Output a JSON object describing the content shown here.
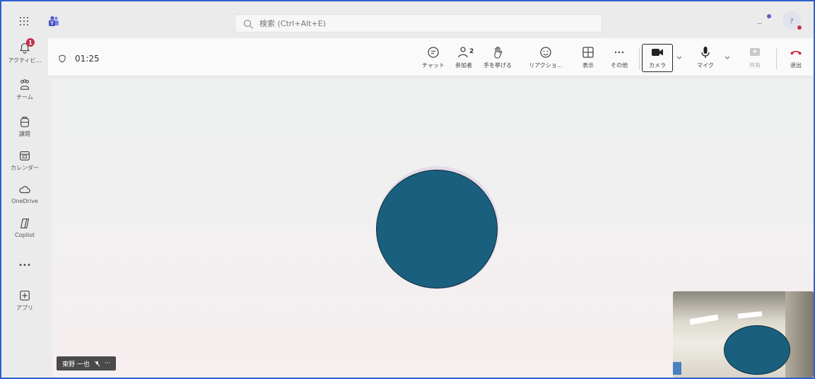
{
  "search": {
    "placeholder": "検索 (Ctrl+Alt+E)"
  },
  "top_avatar": {
    "initial": "ｱ"
  },
  "rail": {
    "items": [
      {
        "label": "アクティビ…",
        "badge": "1"
      },
      {
        "label": "チーム"
      },
      {
        "label": "課題"
      },
      {
        "label": "カレンダー"
      },
      {
        "label": "OneDrive"
      },
      {
        "label": "Copilot"
      },
      {
        "label": "•••"
      },
      {
        "label": "アプリ"
      }
    ]
  },
  "meeting": {
    "timer": "01:25",
    "tools": {
      "chat": "チャット",
      "participants": "参加者",
      "participants_count": "2",
      "raise_hand": "手を挙げる",
      "reactions": "リアクショ…",
      "view": "表示",
      "more": "その他",
      "camera": "カメラ",
      "mic": "マイク",
      "share": "共有",
      "leave": "退出"
    }
  },
  "stage": {
    "participant_name": "東野 一也",
    "name_tag_extra": "···"
  },
  "colors": {
    "avatar": "#1a5f7e",
    "leave": "#c4314b",
    "teams_brand": "#5b5fc7"
  }
}
